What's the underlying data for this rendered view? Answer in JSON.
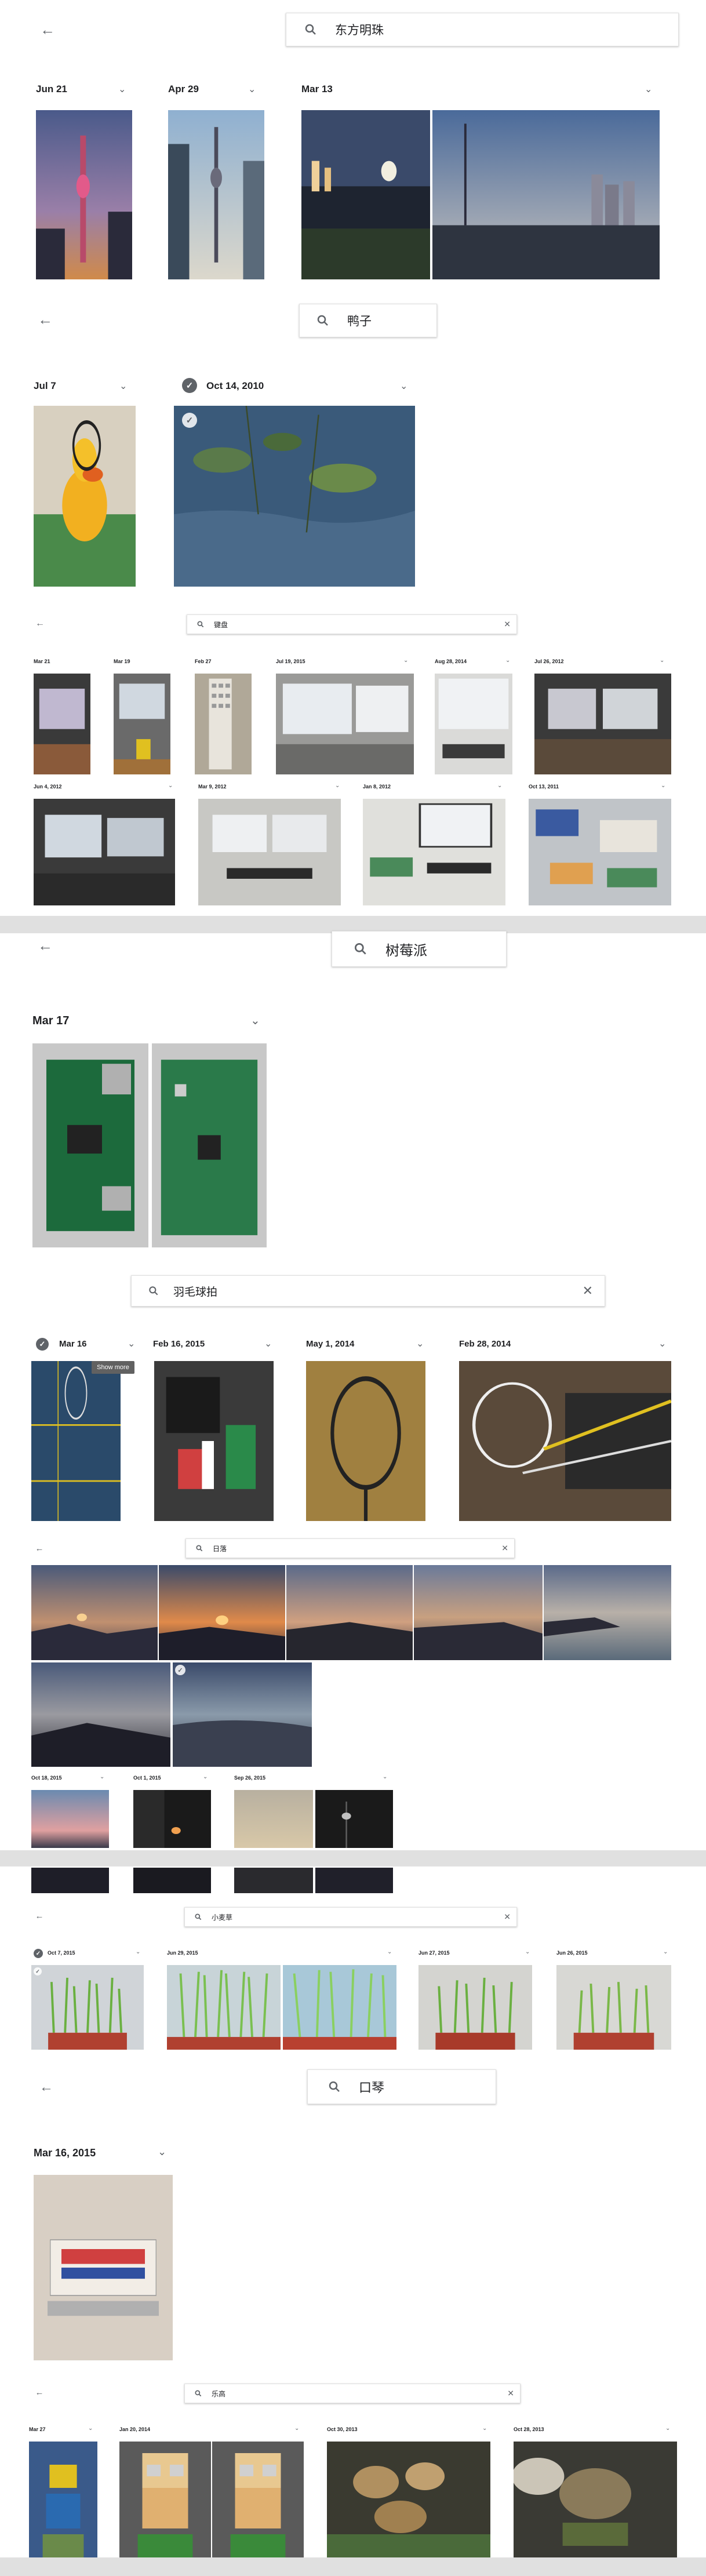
{
  "icons": {
    "back": "arrow-left",
    "search": "magnifier",
    "clear": "close",
    "expand": "chevron-down",
    "selected": "check-circle"
  },
  "colors": {
    "divider": "#e0e0e0",
    "icon": "#5f6368",
    "tooltip": "#616161"
  },
  "s1": {
    "query": "东方明珠",
    "dates": [
      "Jun 21",
      "Apr 29",
      "Mar 13"
    ]
  },
  "s2": {
    "query": "鸭子",
    "dates": [
      "Jul 7",
      "Oct 14, 2010"
    ]
  },
  "s3": {
    "query": "键盘",
    "dates": [
      "Mar 21",
      "Mar 19",
      "Feb 27",
      "Jul 19, 2015",
      "Aug 28, 2014",
      "Jul 26, 2012",
      "Jun 4, 2012",
      "Mar 9, 2012",
      "Jan 8, 2012",
      "Oct 13, 2011"
    ]
  },
  "s4": {
    "query": "树莓派",
    "dates": [
      "Mar 17"
    ]
  },
  "s5": {
    "query": "羽毛球拍",
    "dates": [
      "Mar 16",
      "Feb 16, 2015",
      "May 1, 2014",
      "Feb 28, 2014"
    ],
    "tooltip": "Show more"
  },
  "s6": {
    "query": "日落",
    "dates": [
      "Oct 18, 2015",
      "Oct 1, 2015",
      "Sep 26, 2015"
    ]
  },
  "s7": {
    "query": "小麦草",
    "dates": [
      "Oct 7, 2015",
      "Jun 29, 2015",
      "Jun 27, 2015",
      "Jun 26, 2015"
    ]
  },
  "s8": {
    "query": "口琴",
    "dates": [
      "Mar 16, 2015"
    ]
  },
  "s9": {
    "query": "乐高",
    "dates": [
      "Mar 27",
      "Jan 20, 2014",
      "Oct 30, 2013",
      "Oct 28, 2013"
    ]
  }
}
